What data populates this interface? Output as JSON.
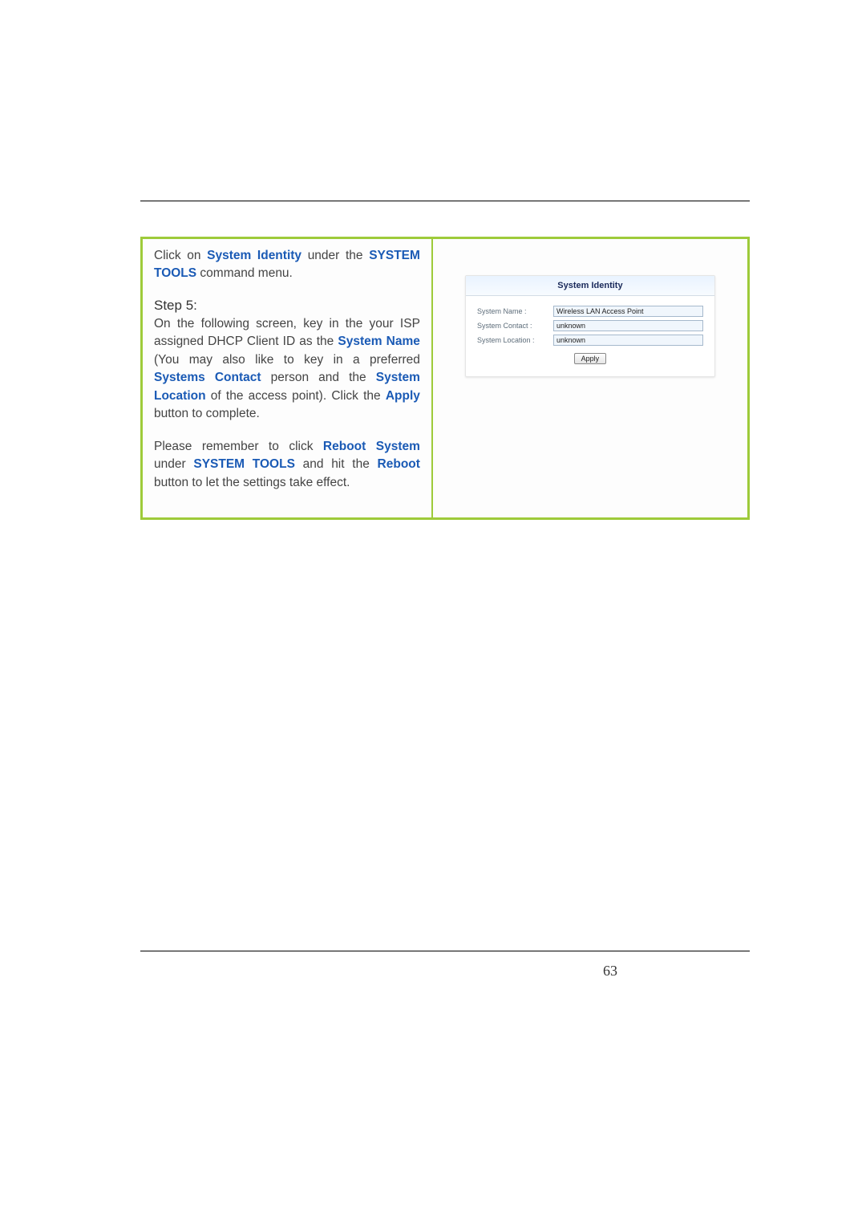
{
  "page_number": "63",
  "instructions": {
    "para1_pre": "Click on ",
    "kw_system_identity": "System Identity",
    "para1_mid": " under the ",
    "kw_system_tools1": "SYSTEM TOOLS",
    "para1_post": " command menu.",
    "step_heading": "Step 5:",
    "para2_a": "On the following screen, key in the your ISP assigned DHCP Client ID as the ",
    "kw_system_name": "System Name",
    "para2_b": " (You may also like to key in a preferred ",
    "kw_systems_contact": "Systems Contact",
    "para2_c": " person and the ",
    "kw_system_location": "System Location",
    "para2_d": " of the access point). Click the ",
    "kw_apply": "Apply",
    "para2_e": " button to complete.",
    "para3_a": "Please remember to click ",
    "kw_reboot_system": "Reboot System",
    "para3_b": " under ",
    "kw_system_tools2": "SYSTEM TOOLS",
    "para3_c": " and hit the ",
    "kw_reboot": "Reboot",
    "para3_d": " button to let the settings take effect."
  },
  "panel": {
    "title": "System Identity",
    "fields": {
      "system_name_label": "System Name :",
      "system_name_value": "Wireless LAN Access Point",
      "system_contact_label": "System Contact :",
      "system_contact_value": "unknown",
      "system_location_label": "System Location :",
      "system_location_value": "unknown"
    },
    "apply_button": "Apply"
  }
}
